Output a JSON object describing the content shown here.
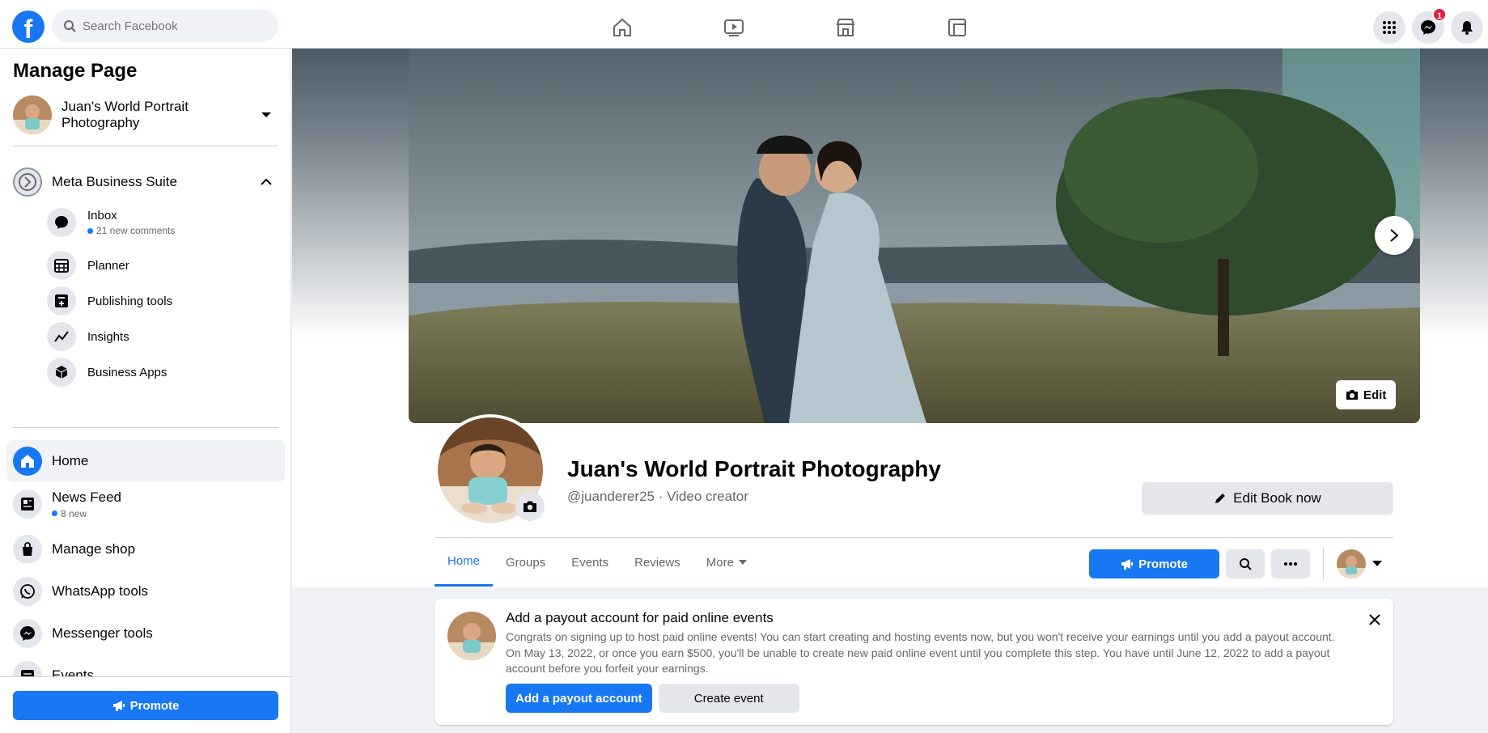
{
  "topbar": {
    "logo": "f",
    "search_placeholder": "Search Facebook",
    "nav_icons": [
      "home-icon",
      "watch-icon",
      "marketplace-icon",
      "gaming-icon"
    ],
    "messenger_badge": "1"
  },
  "sidebar": {
    "title": "Manage Page",
    "page_name": "Juan's World Portrait Photography",
    "business_suite": "Meta Business Suite",
    "suite_items": [
      {
        "label": "Inbox",
        "meta": "21 new comments"
      },
      {
        "label": "Planner"
      },
      {
        "label": "Publishing tools"
      },
      {
        "label": "Insights"
      },
      {
        "label": "Business Apps"
      }
    ],
    "nav": [
      {
        "label": "Home"
      },
      {
        "label": "News Feed",
        "meta": "8 new"
      },
      {
        "label": "Manage shop"
      },
      {
        "label": "WhatsApp tools"
      },
      {
        "label": "Messenger tools"
      },
      {
        "label": "Events"
      }
    ],
    "promote": "Promote"
  },
  "main": {
    "cover_edit": "Edit",
    "page_title": "Juan's World Portrait Photography",
    "page_sub": "@juanderer25 · Video creator",
    "book_button": "Edit Book now",
    "tabs": [
      "Home",
      "Groups",
      "Events",
      "Reviews",
      "More"
    ],
    "promote": "Promote"
  },
  "notice": {
    "title": "Add a payout account for paid online events",
    "body": "Congrats on signing up to host paid online events! You can start creating and hosting events now, but you won't receive your earnings until you add a payout account. On May 13, 2022, or once you earn $500, you'll be unable to create new paid online event until you complete this step. You have until June 12, 2022 to add a payout account before you forfeit your earnings.",
    "primary": "Add a payout account",
    "secondary": "Create event"
  },
  "colors": {
    "accent": "#1877f2",
    "badge": "#e41e3f"
  }
}
